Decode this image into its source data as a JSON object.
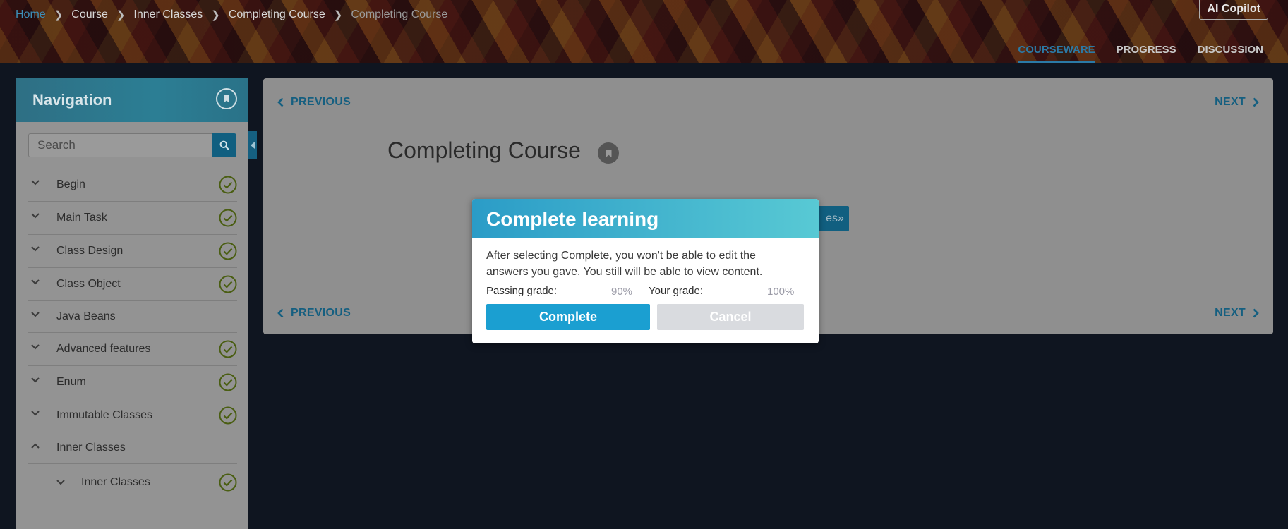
{
  "breadcrumb": [
    "Home",
    "Course",
    "Inner Classes",
    "Completing Course",
    "Completing Course"
  ],
  "copilot_label": "AI Copilot",
  "tabs": [
    {
      "label": "COURSEWARE",
      "active": true
    },
    {
      "label": "PROGRESS",
      "active": false
    },
    {
      "label": "DISCUSSION",
      "active": false
    }
  ],
  "nav": {
    "title": "Navigation",
    "search_placeholder": "Search",
    "items": [
      {
        "label": "Begin",
        "expanded": false,
        "completed": true
      },
      {
        "label": "Main Task",
        "expanded": false,
        "completed": true
      },
      {
        "label": "Class Design",
        "expanded": false,
        "completed": true
      },
      {
        "label": "Class Object",
        "expanded": false,
        "completed": true
      },
      {
        "label": "Java Beans",
        "expanded": false,
        "completed": false
      },
      {
        "label": "Advanced features",
        "expanded": false,
        "completed": true
      },
      {
        "label": "Enum",
        "expanded": false,
        "completed": true
      },
      {
        "label": "Immutable Classes",
        "expanded": false,
        "completed": true
      },
      {
        "label": "Inner Classes",
        "expanded": true,
        "completed": false
      },
      {
        "label": "Inner Classes",
        "expanded": false,
        "completed": true,
        "sub": true
      }
    ]
  },
  "content": {
    "previous_label": "PREVIOUS",
    "next_label": "NEXT",
    "unit_title": "Completing Course",
    "hidden_button_label": "es»"
  },
  "modal": {
    "title": "Complete learning",
    "body": "After selecting Complete, you won't be able to edit the answers you gave. You still will be able to view content.",
    "passing_label": "Passing grade:",
    "passing_value": "90%",
    "your_label": "Your grade:",
    "your_value": "100%",
    "complete_label": "Complete",
    "cancel_label": "Cancel"
  },
  "colors": {
    "accent": "#1b9fd1",
    "link": "#155f80",
    "check": "#4a5e12"
  },
  "icons": [
    "chevron-right-icon",
    "bookmark-icon",
    "search-icon",
    "chevron-down-icon",
    "chevron-up-icon",
    "check-circle-icon",
    "chevron-left-icon",
    "caret-left-icon"
  ]
}
